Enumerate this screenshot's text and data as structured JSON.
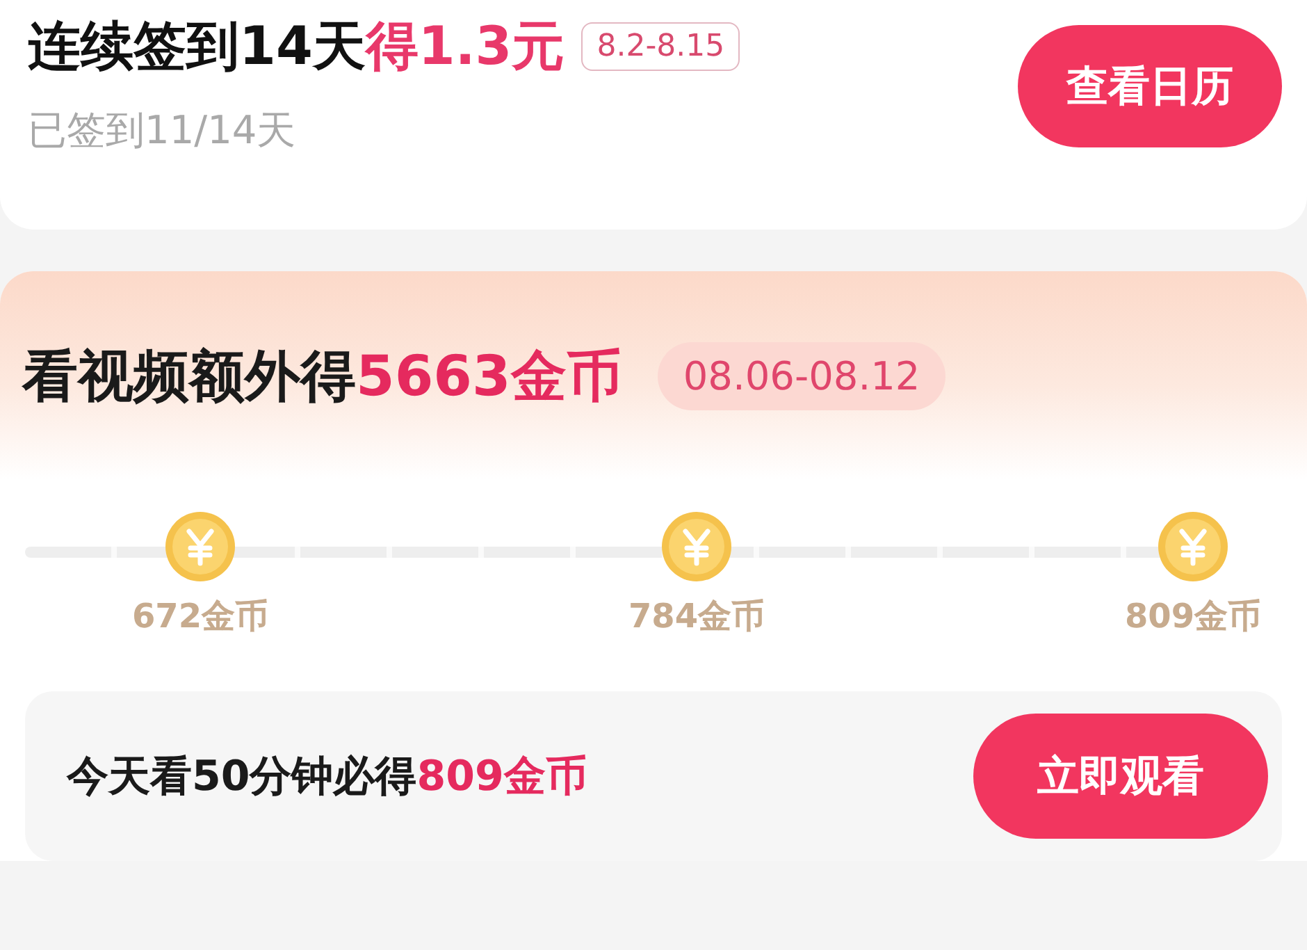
{
  "checkin": {
    "title": "连续签到14天",
    "reward": "得1.3元",
    "period": "8.2-8.15",
    "progress": "已签到11/14天",
    "button": "查看日历"
  },
  "video": {
    "title": "看视频额外得",
    "reward": "5663金币",
    "period": "08.06-08.12",
    "milestones": [
      {
        "label": "672金币"
      },
      {
        "label": "784金币"
      },
      {
        "label": "809金币"
      }
    ],
    "task": {
      "text": "今天看50分钟必得",
      "reward": "809金币",
      "button": "立即观看"
    }
  }
}
